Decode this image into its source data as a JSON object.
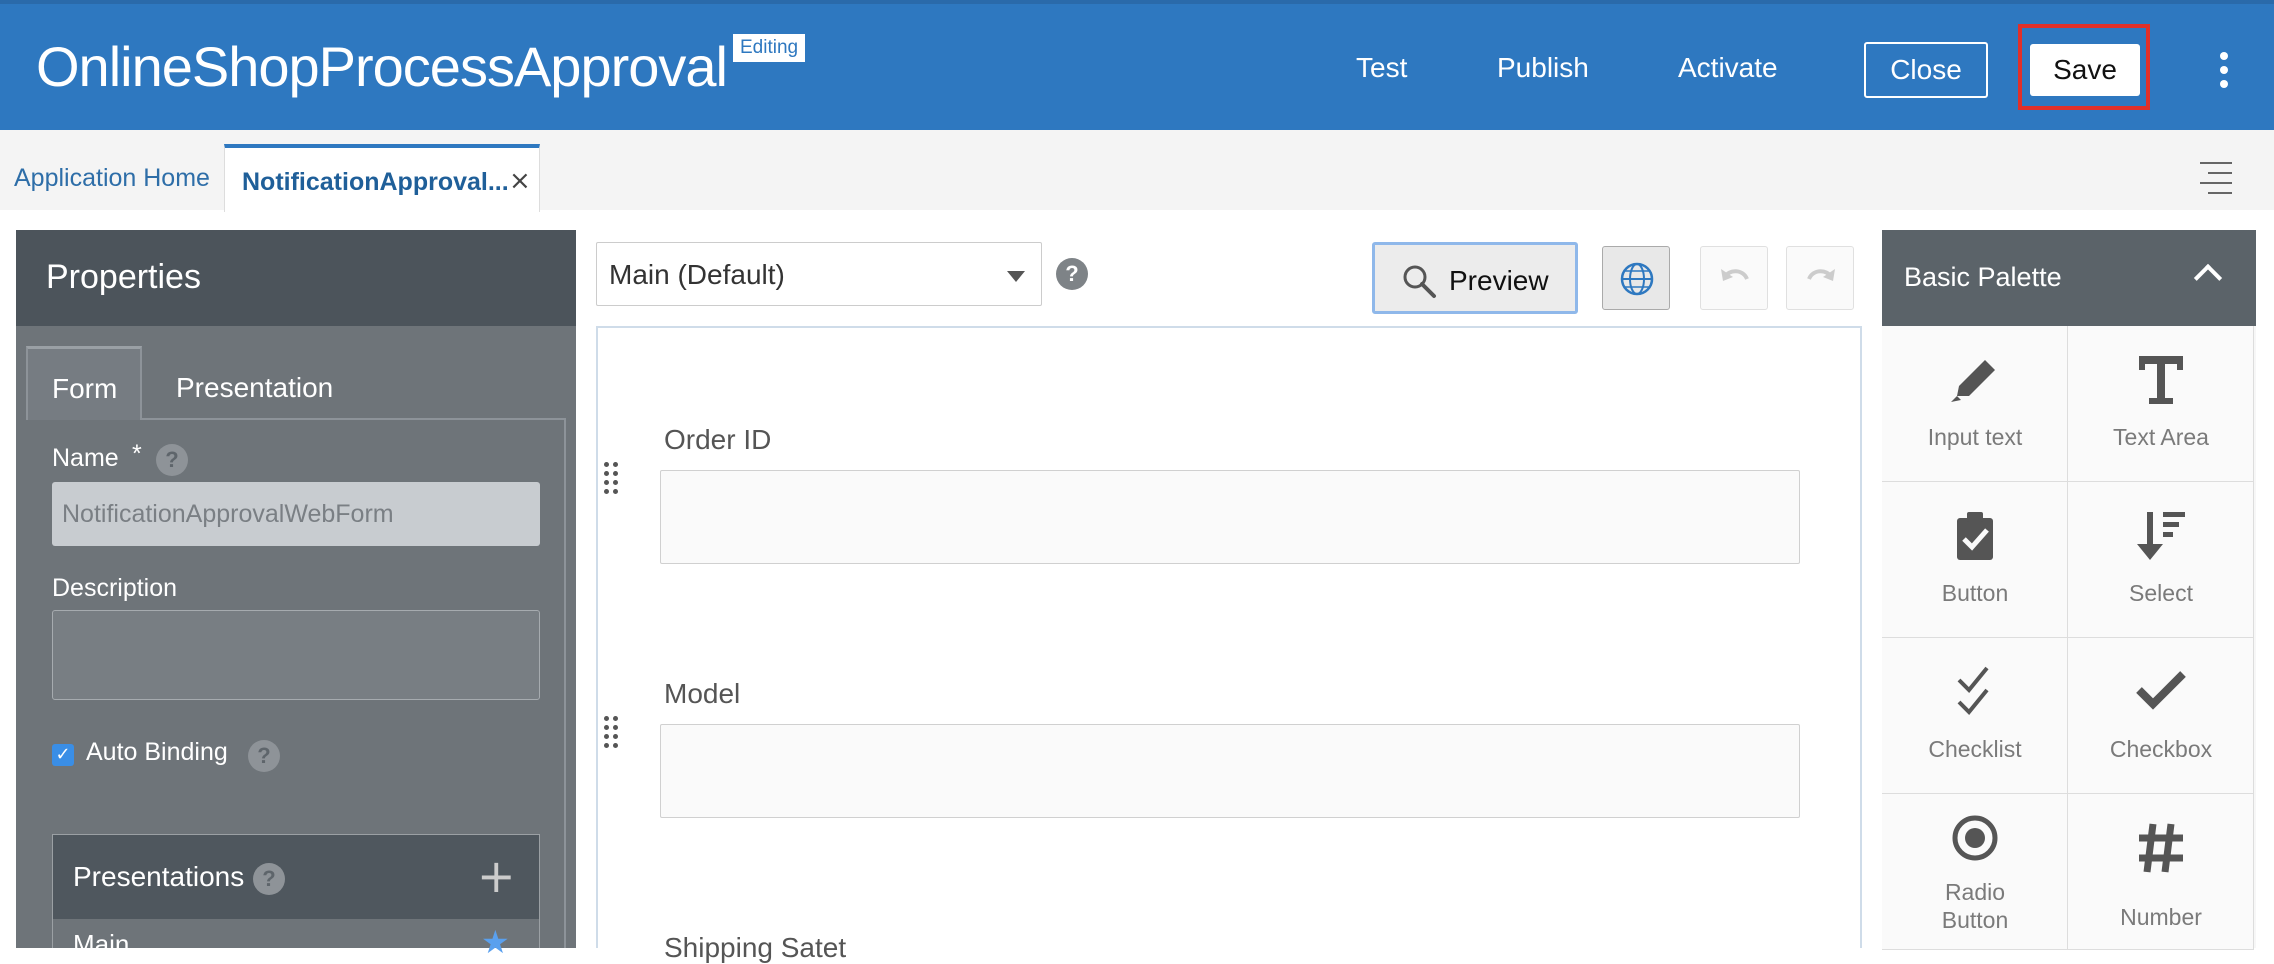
{
  "header": {
    "app_title": "OnlineShopProcessApproval",
    "editing_badge": "Editing",
    "test_label": "Test",
    "publish_label": "Publish",
    "activate_label": "Activate",
    "close_label": "Close",
    "save_label": "Save",
    "more_icon": "kebab-vertical-icon"
  },
  "tabs": {
    "home_label": "Application Home",
    "active_label": "NotificationApproval...",
    "close_glyph": "×"
  },
  "properties": {
    "title": "Properties",
    "tab_form": "Form",
    "tab_presentation": "Presentation",
    "name_label": "Name",
    "required_mark": "*",
    "help_glyph": "?",
    "name_value": "NotificationApprovalWebForm",
    "description_label": "Description",
    "description_value": "",
    "auto_binding_label": "Auto Binding",
    "auto_binding_checked": true,
    "presentations_title": "Presentations",
    "presentation_items": [
      "Main"
    ]
  },
  "editor": {
    "presentation_select": "Main (Default)",
    "preview_label": "Preview",
    "fields": [
      {
        "label": "Order ID",
        "value": ""
      },
      {
        "label": "Model",
        "value": ""
      },
      {
        "label": "Shipping Satet",
        "value": ""
      }
    ]
  },
  "palette": {
    "title": "Basic Palette",
    "items": [
      {
        "label": "Input text",
        "icon": "pencil-icon"
      },
      {
        "label": "Text Area",
        "icon": "text-t-icon"
      },
      {
        "label": "Button",
        "icon": "clipboard-check-icon"
      },
      {
        "label": "Select",
        "icon": "sort-down-icon"
      },
      {
        "label": "Checklist",
        "icon": "double-check-icon"
      },
      {
        "label": "Checkbox",
        "icon": "check-icon"
      },
      {
        "label": "Radio Button",
        "icon": "radio-icon"
      },
      {
        "label": "Number",
        "icon": "hash-icon"
      }
    ]
  },
  "colors": {
    "header_bg": "#2e78c0",
    "highlight_border": "#e0302a",
    "properties_bg": "#6e7479",
    "palette_header_bg": "#5b6369"
  }
}
